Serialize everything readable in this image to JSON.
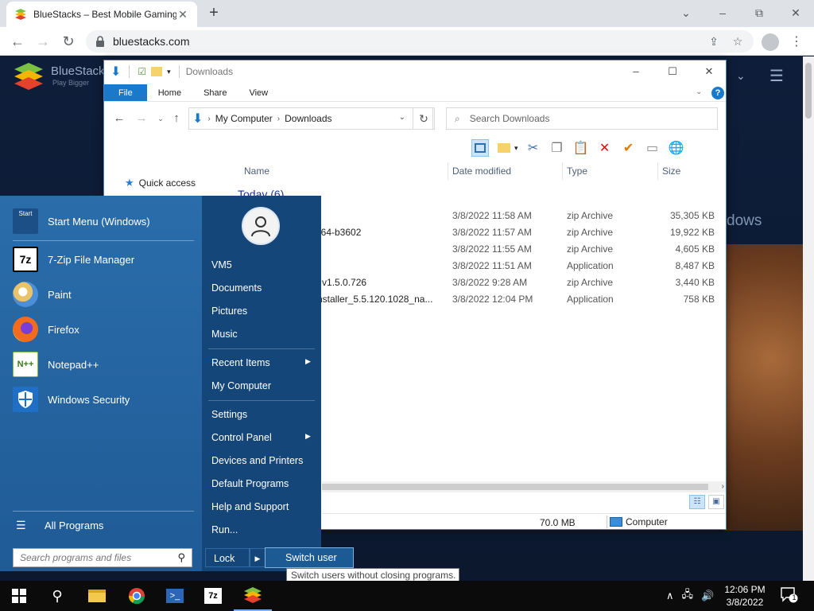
{
  "browser": {
    "tab_title": "BlueStacks – Best Mobile Gaming",
    "url": "bluestacks.com",
    "window_controls": {
      "chevron": "⌄",
      "minimize": "–",
      "restore": "⧉",
      "close": "✕"
    }
  },
  "webpage": {
    "brand": "BlueStacks",
    "tagline": "Play Bigger",
    "hero_text_partial": "dows"
  },
  "explorer": {
    "title": "Downloads",
    "ribbon_tabs": [
      "File",
      "Home",
      "Share",
      "View"
    ],
    "address": {
      "root": "My Computer",
      "folder": "Downloads"
    },
    "search_placeholder": "Search Downloads",
    "nav_pane": {
      "quick_access": "Quick access"
    },
    "columns": {
      "name": "Name",
      "date": "Date modified",
      "type": "Type",
      "size": "Size"
    },
    "group_header": "Today (6)",
    "files": [
      {
        "name": "6",
        "date": "3/8/2022 11:58 AM",
        "type": "zip Archive",
        "size": "35,305 KB"
      },
      {
        "name": "ws-64-b3602",
        "date": "3/8/2022 11:57 AM",
        "type": "zip Archive",
        "size": "19,922 KB"
      },
      {
        "name": "",
        "date": "3/8/2022 11:55 AM",
        "type": "zip Archive",
        "size": "4,605 KB"
      },
      {
        "name": "",
        "date": "3/8/2022 11:51 AM",
        "type": "Application",
        "size": "8,487 KB"
      },
      {
        "name": "der.v1.5.0.726",
        "date": "3/8/2022 9:28 AM",
        "type": "zip Archive",
        "size": "3,440 KB"
      },
      {
        "name": "roInstaller_5.5.120.1028_na...",
        "date": "3/8/2022 12:04 PM",
        "type": "Application",
        "size": "758 KB"
      }
    ],
    "status": {
      "selected_size": "70.0 MB",
      "location": "Computer"
    }
  },
  "start_menu": {
    "pinned": [
      {
        "label": "Start Menu (Windows)",
        "icon": "start-menu-icon"
      }
    ],
    "programs": [
      {
        "label": "7-Zip File Manager",
        "icon": "7zip-icon"
      },
      {
        "label": "Paint",
        "icon": "paint-icon"
      },
      {
        "label": "Firefox",
        "icon": "firefox-icon"
      },
      {
        "label": "Notepad++",
        "icon": "notepadpp-icon"
      },
      {
        "label": "Windows Security",
        "icon": "shield-icon"
      }
    ],
    "all_programs": "All Programs",
    "search_placeholder": "Search programs and files",
    "right_links": {
      "user": "VM5",
      "documents": "Documents",
      "pictures": "Pictures",
      "music": "Music",
      "recent_items": "Recent Items",
      "my_computer": "My Computer",
      "settings": "Settings",
      "control_panel": "Control Panel",
      "devices_printers": "Devices and Printers",
      "default_programs": "Default Programs",
      "help_support": "Help and Support",
      "run": "Run..."
    },
    "lock": "Lock",
    "switch_user": "Switch user",
    "tooltip": "Switch users without closing programs."
  },
  "taskbar": {
    "time": "12:06 PM",
    "date": "3/8/2022",
    "notification_count": "1"
  }
}
